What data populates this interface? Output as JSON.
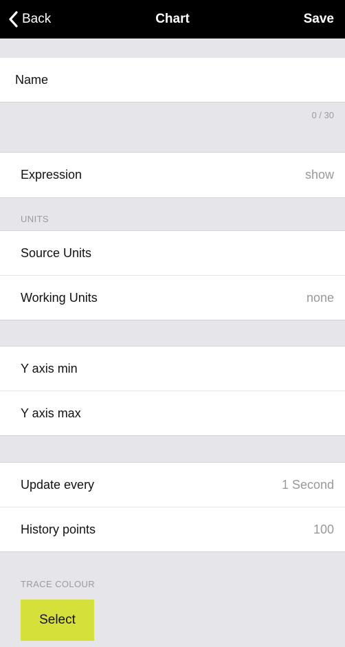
{
  "navbar": {
    "back_label": "Back",
    "title": "Chart",
    "save_label": "Save"
  },
  "name_field": {
    "placeholder": "Name",
    "value": "",
    "counter": "0 / 30"
  },
  "expression": {
    "label": "Expression",
    "value": "show"
  },
  "units": {
    "header": "UNITS",
    "source_label": "Source Units",
    "source_value": "",
    "working_label": "Working Units",
    "working_value": "none"
  },
  "y_axis": {
    "min_label": "Y axis min",
    "max_label": "Y axis max"
  },
  "update": {
    "label": "Update every",
    "value": "1 Second"
  },
  "history": {
    "label": "History points",
    "value": "100"
  },
  "trace_colour": {
    "header": "TRACE COLOUR",
    "button_label": "Select",
    "button_color": "#d6e03a"
  },
  "icons": {
    "back": "chevron-left-icon"
  }
}
